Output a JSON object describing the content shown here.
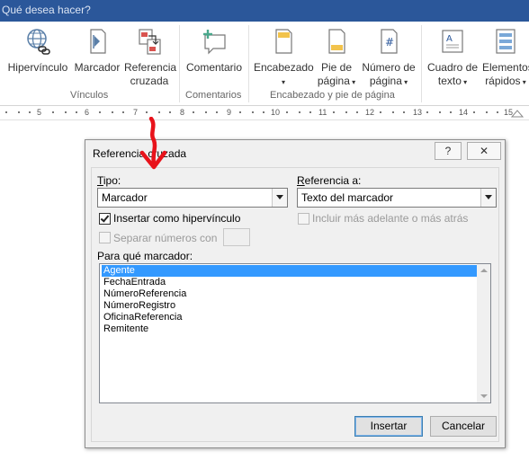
{
  "tell_me": "Qué desea hacer?",
  "ribbon": {
    "links": {
      "hyperlink": "Hipervínculo",
      "bookmark": "Marcador",
      "cross_ref_1": "Referencia",
      "cross_ref_2": "cruzada",
      "group": "Vínculos"
    },
    "comments": {
      "comment": "Comentario",
      "group": "Comentarios"
    },
    "header_footer": {
      "header": "Encabezado",
      "footer_1": "Pie de",
      "footer_2": "página",
      "pagenum_1": "Número de",
      "pagenum_2": "página",
      "group": "Encabezado y pie de página"
    },
    "text": {
      "textbox_1": "Cuadro de",
      "textbox_2": "texto",
      "quick_1": "Elementos",
      "quick_2": "rápidos"
    }
  },
  "ruler": [
    "5",
    "6",
    "7",
    "8",
    "9",
    "10",
    "11",
    "12",
    "13",
    "14",
    "15"
  ],
  "dialog": {
    "title": "Referencia cruzada",
    "help": "?",
    "close": "✕",
    "type_label": "Tipo:",
    "type_value": "Marcador",
    "ref_label": "Referencia a:",
    "ref_value": "Texto del marcador",
    "insert_hyperlink": "Insertar como hipervínculo",
    "include_above_below": "Incluir más adelante o más atrás",
    "separate_numbers": "Separar números con",
    "for_which_label": "Para qué marcador:",
    "items": [
      "Agente",
      "FechaEntrada",
      "NúmeroReferencia",
      "NúmeroRegistro",
      "OficinaReferencia",
      "Remitente"
    ],
    "insert_btn": "Insertar",
    "cancel_btn": "Cancelar"
  },
  "colors": {
    "titlebar": "#2b579a",
    "selection": "#3399ff",
    "arrow": "#e8131b"
  }
}
